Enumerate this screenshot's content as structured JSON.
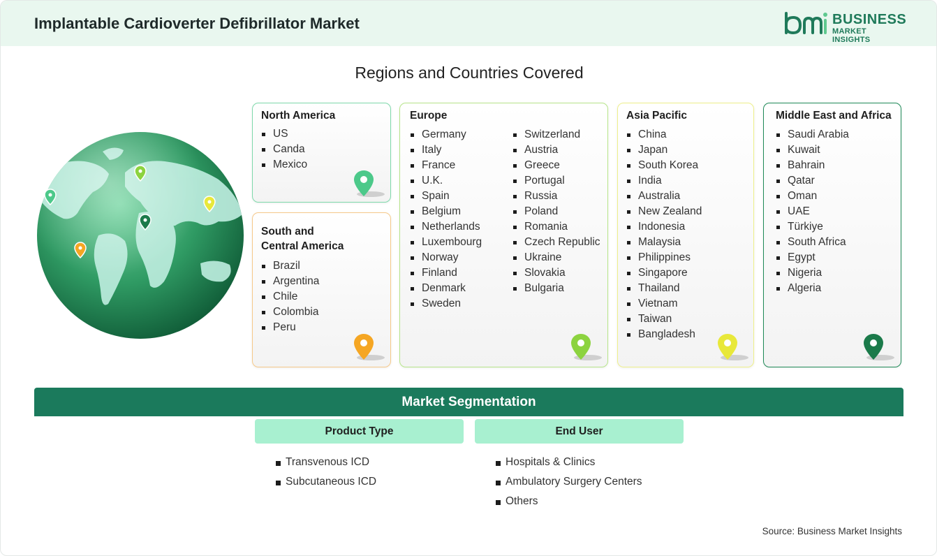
{
  "header": {
    "title": "Implantable Cardioverter Defibrillator Market",
    "logo_line1": "BUSINESS",
    "logo_line2": "MARKET INSIGHTS"
  },
  "regions_title": "Regions and Countries Covered",
  "regions": {
    "north_america": {
      "title": "North America",
      "countries": [
        "US",
        "Canda",
        "Mexico"
      ],
      "color": "#4cc98a"
    },
    "south_central_america": {
      "title_line1": "South and",
      "title_line2": "Central America",
      "countries": [
        "Brazil",
        "Argentina",
        "Chile",
        "Colombia",
        "Peru"
      ],
      "color": "#f5a623"
    },
    "europe": {
      "title": "Europe",
      "countries_col1": [
        "Germany",
        "Italy",
        "France",
        "U.K.",
        "Spain",
        "Belgium",
        "Netherlands",
        "Luxembourg",
        "Norway",
        "Finland",
        "Denmark",
        "Sweden"
      ],
      "countries_col2": [
        "Switzerland",
        "Austria",
        "Greece",
        "Portugal",
        "Russia",
        "Poland",
        "Romania",
        "Czech Republic",
        "Ukraine",
        "Slovakia",
        "Bulgaria"
      ],
      "color": "#8cd33f"
    },
    "asia_pacific": {
      "title": "Asia Pacific",
      "countries": [
        "China",
        "Japan",
        "South Korea",
        "India",
        "Australia",
        "New Zealand",
        "Indonesia",
        "Malaysia",
        "Philippines",
        "Singapore",
        "Thailand",
        "Vietnam",
        "Taiwan",
        "Bangladesh"
      ],
      "color": "#e8e83a"
    },
    "middle_east_africa": {
      "title": "Middle East and Africa",
      "countries": [
        "Saudi Arabia",
        "Kuwait",
        "Bahrain",
        "Qatar",
        "Oman",
        "UAE",
        "Türkiye",
        "South Africa",
        "Egypt",
        "Nigeria",
        "Algeria"
      ],
      "color": "#1b7a4a"
    }
  },
  "segmentation": {
    "title": "Market Segmentation",
    "product_type": {
      "title": "Product Type",
      "items": [
        "Transvenous ICD",
        "Subcutaneous ICD"
      ]
    },
    "end_user": {
      "title": "End User",
      "items": [
        "Hospitals & Clinics",
        "Ambulatory Surgery Centers",
        "Others"
      ]
    }
  },
  "source": "Source: Business Market Insights",
  "colors": {
    "brand": "#1b7a5c",
    "header_bg": "#e9f7ef",
    "segment_head": "#a8f0d0"
  }
}
